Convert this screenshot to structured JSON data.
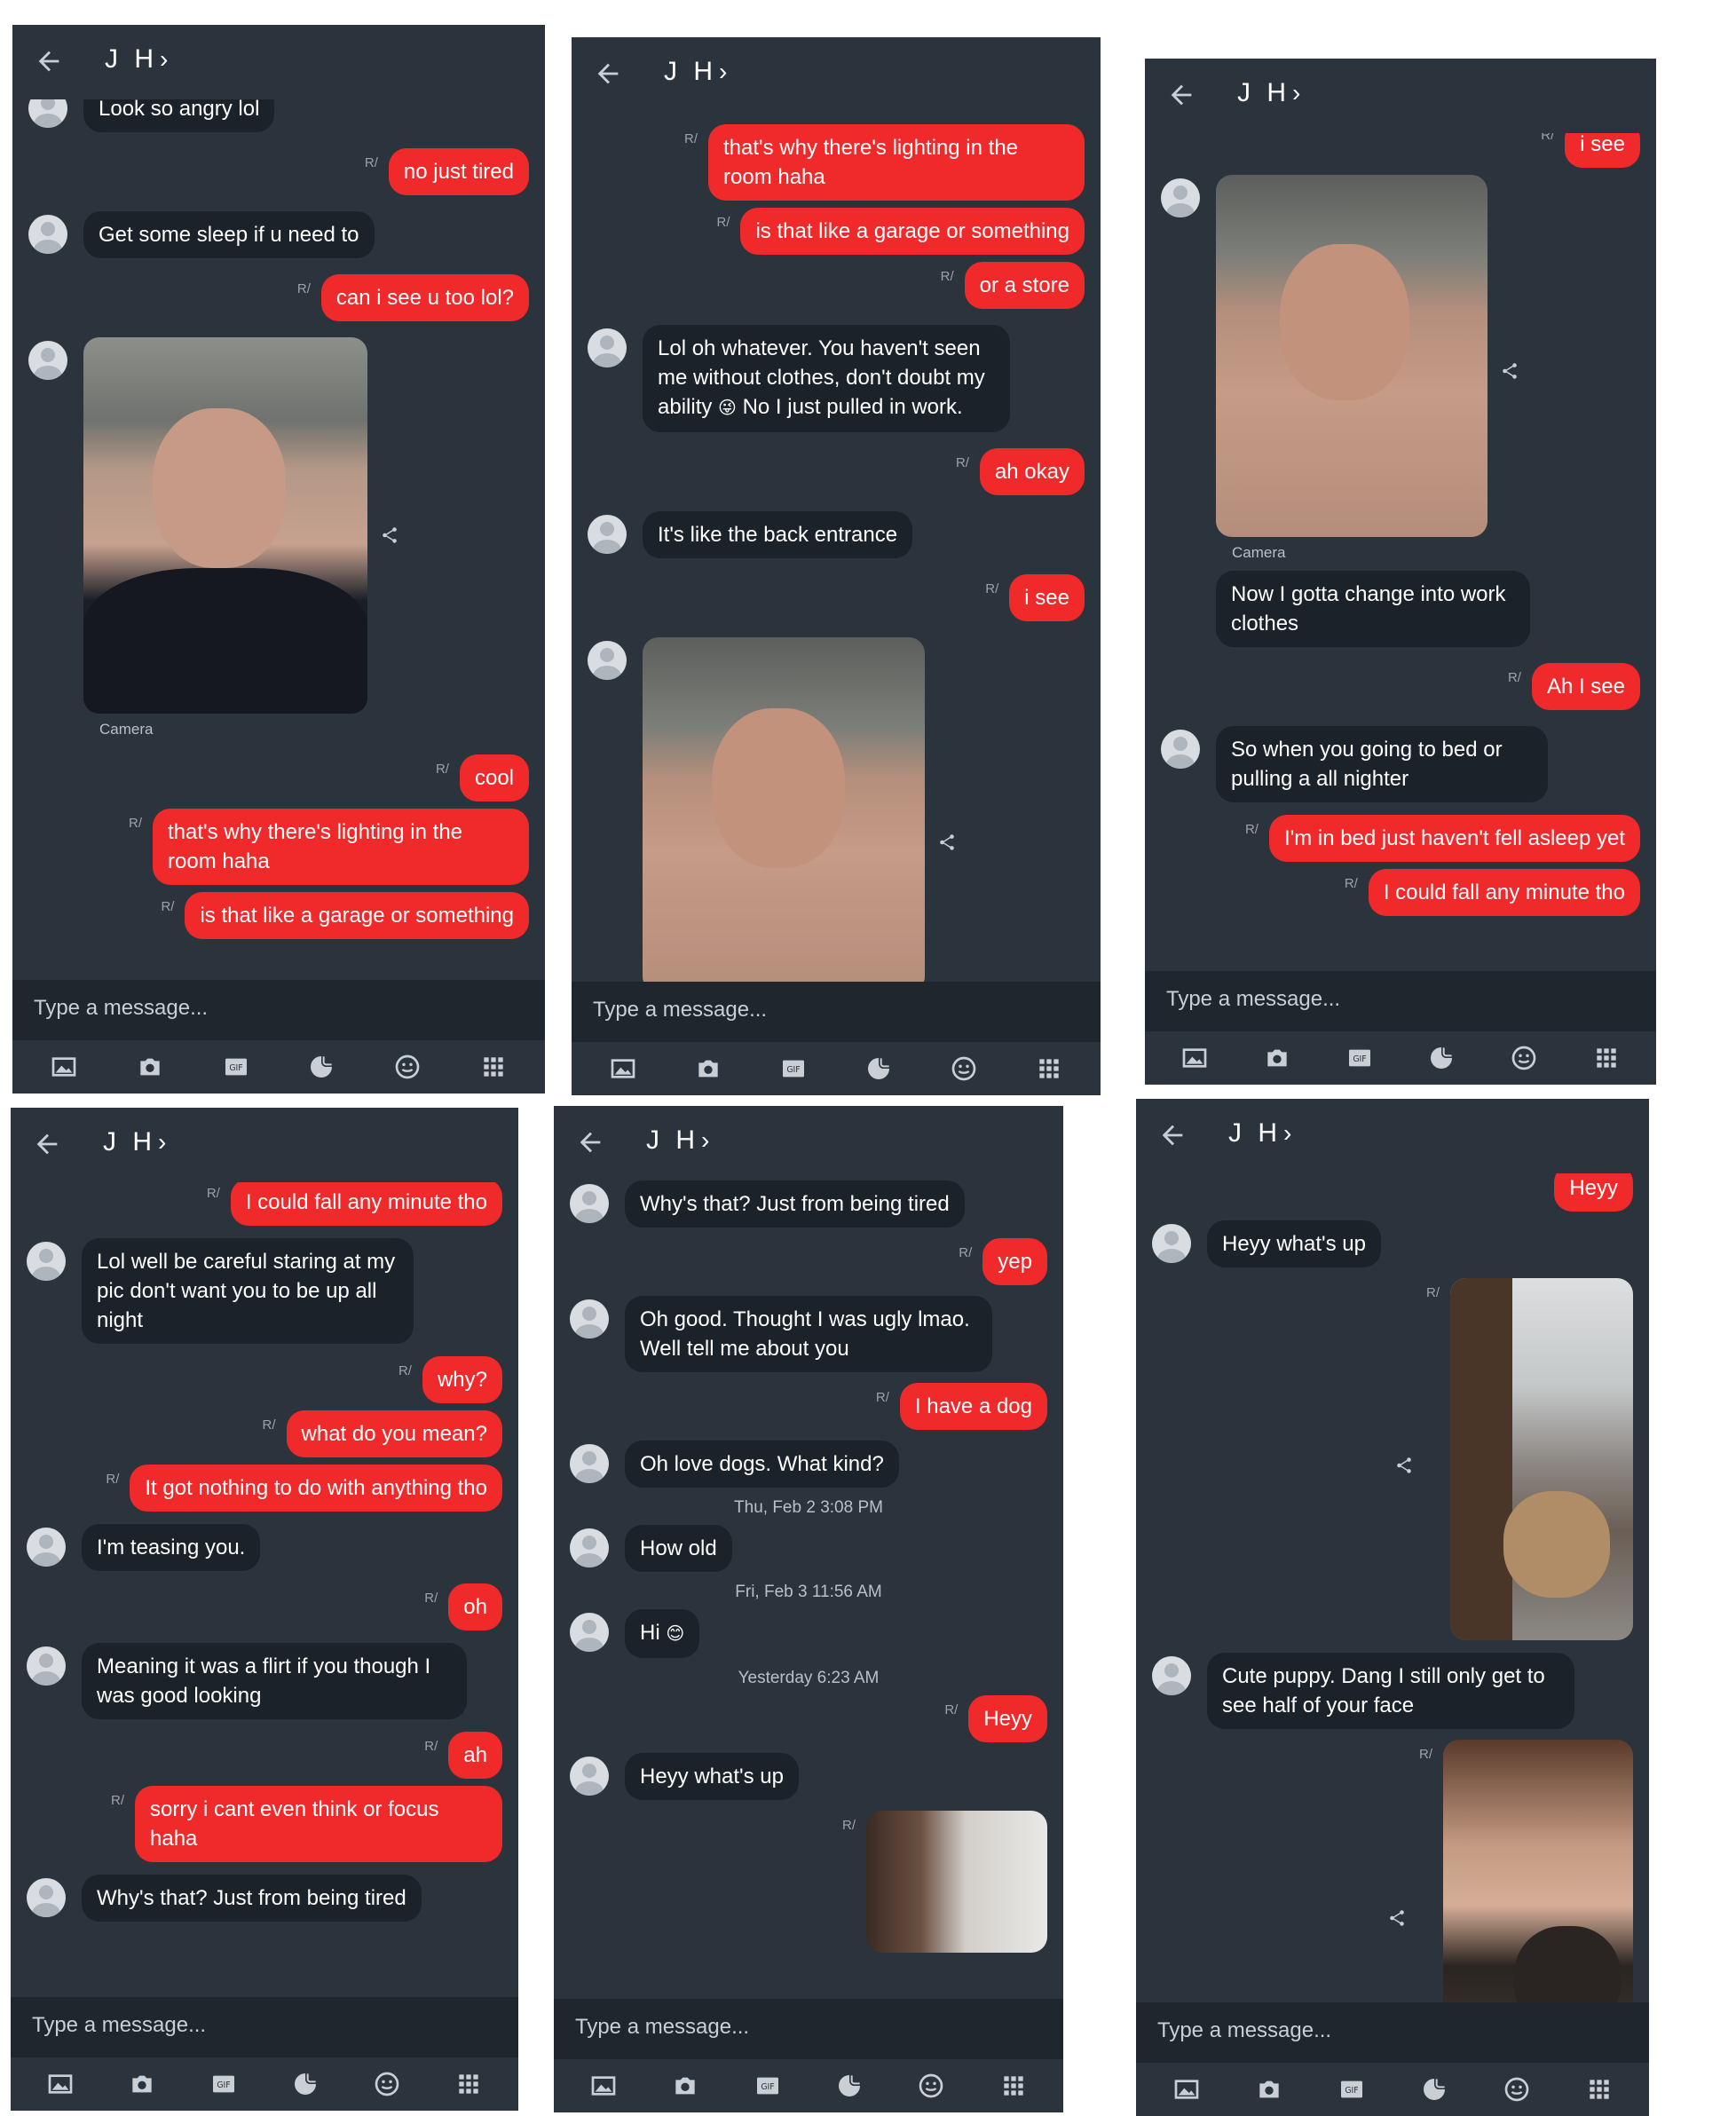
{
  "contact": {
    "name": "J H",
    "chevron": "›"
  },
  "compose_placeholder": "Type a message...",
  "camera_label": "Camera",
  "toolbar_icons": [
    "gallery-icon",
    "camera-icon",
    "gif-icon",
    "sticker-icon",
    "emoji-icon",
    "apps-grid-icon"
  ],
  "gif_label": "GIF",
  "sent_marker": "R/",
  "colors": {
    "background": "#2b333c",
    "incoming": "#1b222a",
    "outgoing": "#f0292b",
    "compose": "#1f262e"
  },
  "screens": [
    {
      "messages": [
        {
          "dir": "in",
          "text": "Look so angry lol"
        },
        {
          "dir": "out",
          "text": "no just tired"
        },
        {
          "dir": "in",
          "text": "Get some sleep if u need to"
        },
        {
          "dir": "out",
          "text": "can i see u too lol?"
        },
        {
          "dir": "in",
          "photo": "selfie-dark-hoodie",
          "caption": "Camera"
        },
        {
          "dir": "out",
          "text": "cool"
        },
        {
          "dir": "out",
          "text": "that's why there's lighting in the room haha"
        },
        {
          "dir": "out",
          "text": "is that like a garage or something"
        }
      ]
    },
    {
      "messages": [
        {
          "dir": "out",
          "text": "that's why there's lighting in the room haha"
        },
        {
          "dir": "out",
          "text": "is that like a garage or something"
        },
        {
          "dir": "out",
          "text": "or a store"
        },
        {
          "dir": "in",
          "text": "Lol oh whatever. You haven't seen me without clothes, don't doubt my ability",
          "emoji": "😜",
          "text2": "No I just pulled in work."
        },
        {
          "dir": "out",
          "text": "ah okay"
        },
        {
          "dir": "in",
          "text": "It's like the back entrance"
        },
        {
          "dir": "out",
          "text": "i see"
        },
        {
          "dir": "in",
          "photo": "selfie-shirtless"
        }
      ]
    },
    {
      "messages": [
        {
          "dir": "out",
          "text": "i see"
        },
        {
          "dir": "in",
          "photo": "selfie-shirtless",
          "caption": "Camera"
        },
        {
          "dir": "in",
          "text": "Now I gotta change into work clothes"
        },
        {
          "dir": "out",
          "text": "Ah I see"
        },
        {
          "dir": "in",
          "text": "So when you going to bed or pulling a all nighter"
        },
        {
          "dir": "out",
          "text": "I'm in bed just haven't fell asleep yet"
        },
        {
          "dir": "out",
          "text": "I could fall any minute tho"
        }
      ]
    },
    {
      "messages": [
        {
          "dir": "out",
          "text": "I could fall any minute tho"
        },
        {
          "dir": "in",
          "text": "Lol well be careful staring at my pic don't want you to be up all night"
        },
        {
          "dir": "out",
          "text": "why?"
        },
        {
          "dir": "out",
          "text": "what do you mean?"
        },
        {
          "dir": "out",
          "text": "It got nothing to do with anything tho"
        },
        {
          "dir": "in",
          "text": "I'm teasing you."
        },
        {
          "dir": "out",
          "text": "oh"
        },
        {
          "dir": "in",
          "text": "Meaning it was a flirt if you though I was good looking"
        },
        {
          "dir": "out",
          "text": "ah"
        },
        {
          "dir": "out",
          "text": "sorry i cant even think or focus haha"
        },
        {
          "dir": "in",
          "text": "Why's that? Just from being tired"
        }
      ]
    },
    {
      "messages": [
        {
          "dir": "in",
          "text": "Why's that? Just from being tired"
        },
        {
          "dir": "out",
          "text": "yep"
        },
        {
          "dir": "in",
          "text": "Oh good. Thought I was ugly lmao. Well tell me about you"
        },
        {
          "dir": "out",
          "text": "I have a dog"
        },
        {
          "dir": "in",
          "text": "Oh love dogs. What kind?"
        },
        {
          "ts": "Thu, Feb 2 3:08 PM"
        },
        {
          "dir": "in",
          "text": "How old"
        },
        {
          "ts": "Fri, Feb 3 11:56 AM"
        },
        {
          "dir": "in",
          "text": "Hi",
          "emoji": "😊"
        },
        {
          "ts": "Yesterday 6:23 AM"
        },
        {
          "dir": "out",
          "text": "Heyy"
        },
        {
          "dir": "in",
          "text": "Heyy what's up"
        },
        {
          "dir": "out",
          "photo": "girl-partial-face"
        }
      ]
    },
    {
      "messages": [
        {
          "dir": "out",
          "text": "Heyy"
        },
        {
          "dir": "in",
          "text": "Heyy what's up"
        },
        {
          "dir": "out",
          "photo": "girl-with-pug"
        },
        {
          "dir": "in",
          "text": "Cute puppy. Dang  I still only get to see half of your face"
        },
        {
          "dir": "out",
          "photo": "girl-smiling-pug"
        }
      ]
    }
  ]
}
